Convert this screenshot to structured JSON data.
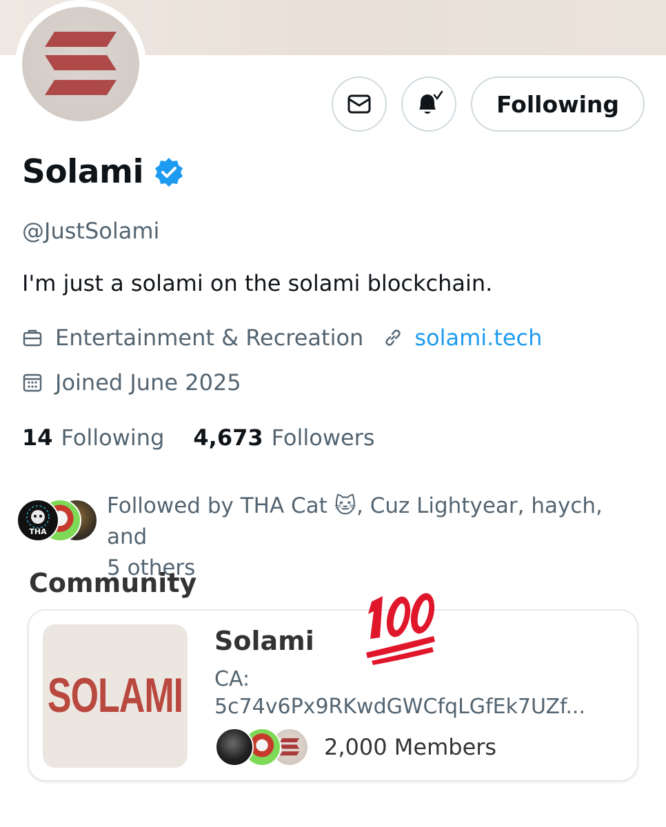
{
  "profile": {
    "display_name": "Solami",
    "verified": true,
    "handle": "@JustSolami",
    "bio": "I'm just a solami on the solami blockchain.",
    "category": "Entertainment & Recreation",
    "website": "solami.tech",
    "joined": "Joined June 2025",
    "following_count": "14",
    "following_label": "Following",
    "followers_count": "4,673",
    "followers_label": "Followers",
    "followed_by_line1": "Followed by THA Cat 🐱, Cuz Lightyear, haych, and",
    "followed_by_line2": "5 others",
    "follower_avatar_badge": "THA"
  },
  "actions": {
    "message_icon": "envelope-icon",
    "notify_icon": "bell-check-icon",
    "follow_label": "Following"
  },
  "community": {
    "section_title": "Community",
    "name": "Solami",
    "image_text": "SOLAMI",
    "ca_label": "CA:",
    "ca_value": "5c74v6Px9RKwdGWCfqLGfEk7UZf...",
    "members": "2,000 Members",
    "sticker": "100-emoji"
  },
  "colors": {
    "accent": "#1d9bf0",
    "text_primary": "#0f1419",
    "text_secondary": "#536471",
    "border": "#cfd9de",
    "emoji_red": "#e0162b"
  }
}
